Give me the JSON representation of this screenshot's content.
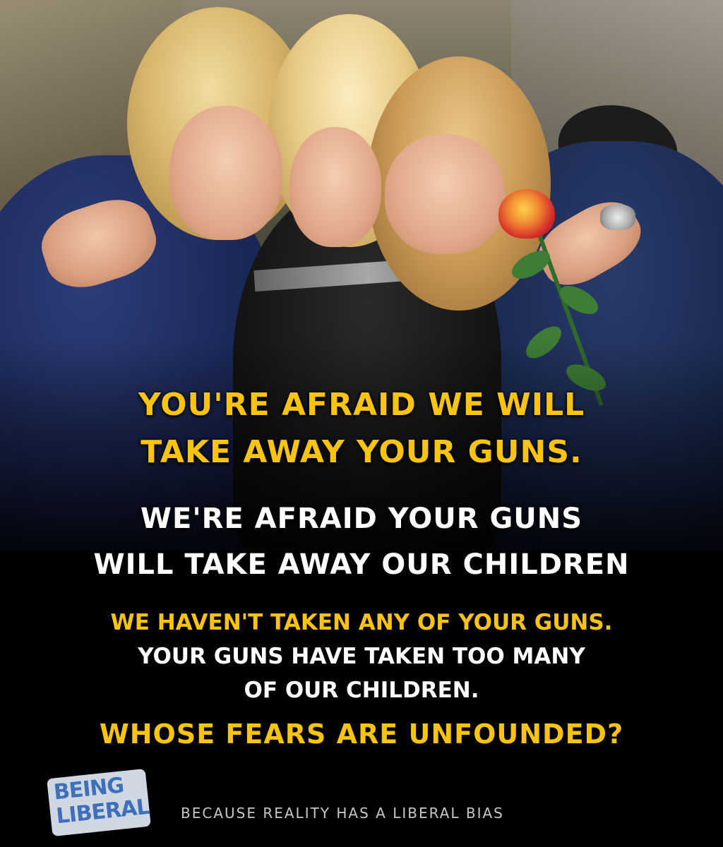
{
  "headline": {
    "line1": "YOU'RE AFRAID WE WILL",
    "line2": "TAKE AWAY YOUR GUNS."
  },
  "response": {
    "line1": "WE'RE AFRAID YOUR GUNS",
    "line2": "WILL TAKE AWAY OUR CHILDREN"
  },
  "body": {
    "line1": "WE HAVEN'T TAKEN ANY OF YOUR GUNS.",
    "line2": "YOUR GUNS HAVE TAKEN TOO MANY",
    "line3": "OF OUR CHILDREN."
  },
  "question": "WHOSE FEARS ARE UNFOUNDED?",
  "brand": {
    "logo_line1": "BEING",
    "logo_line2": "LIBERAL",
    "tagline": "BECAUSE REALITY HAS A LIBERAL BIAS"
  },
  "colors": {
    "accent_yellow": "#f9c312",
    "text_white": "#ffffff",
    "background": "#000000",
    "logo_blue": "#3f6fb8"
  }
}
